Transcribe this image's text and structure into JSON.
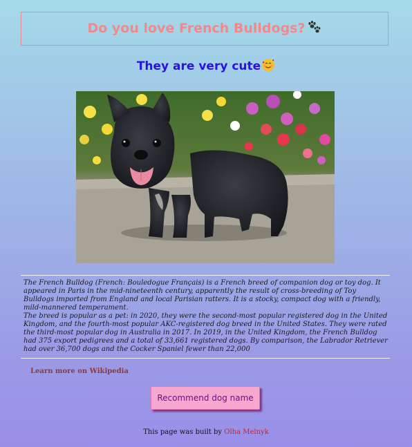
{
  "header": {
    "title": "Do you love French Bulldogs?",
    "title_icon": "paw-prints-icon"
  },
  "subheader": {
    "text": "They are very cute",
    "emoji": "smiling-face-with-hearts-icon"
  },
  "image": {
    "subject": "black French Bulldog puppy standing on pavement with flowers behind"
  },
  "description": {
    "paragraph1": "The French Bulldog (French: Bouledogue Français) is a French breed of companion dog or toy dog. It appeared in Paris in the mid-nineteenth century, apparently the result of cross-breeding of Toy Bulldogs imported from England and local Parisian ratters. It is a stocky, compact dog with a friendly, mild-mannered temperament.",
    "paragraph2": "The breed is popular as a pet: in 2020, they were the second-most popular registered dog in the United Kingdom, and the fourth-most popular AKC-registered dog breed in the United States. They were rated the third-most popular dog in Australia in 2017. In 2019, in the United Kingdom, the French Bulldog had 375 export pedigrees and a total of 33,661 registered dogs. By comparison, the Labrador Retriever had over 36,700 dogs and the Cocker Spaniel fewer than 22,000"
  },
  "links": {
    "wikipedia": "Learn more on Wikipedia"
  },
  "button": {
    "label": "Recommend dog name"
  },
  "footer": {
    "prefix": "This page was built by ",
    "author": "Olha Melnyk"
  },
  "colors": {
    "title": "#f08a8a",
    "subtitle": "#2a12e0",
    "button_bg": "#f7a8d0",
    "link": "#8b3a3a",
    "author_link": "#c0263a"
  }
}
